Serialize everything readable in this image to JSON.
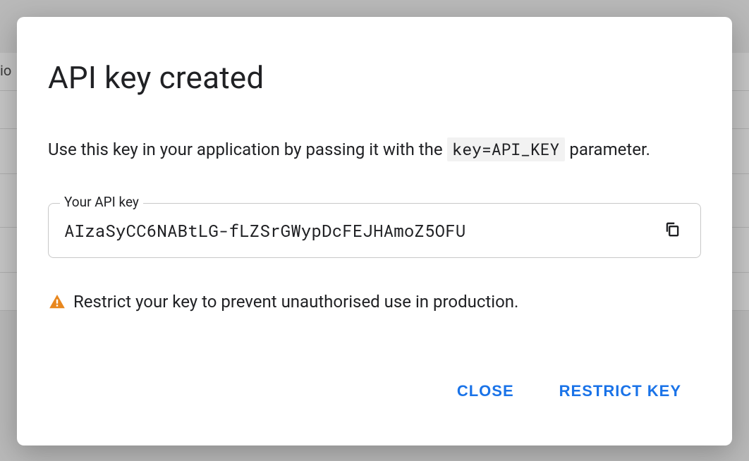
{
  "background": {
    "partial_label": "io"
  },
  "dialog": {
    "title": "API key created",
    "intro_prefix": "Use this key in your application by passing it with the ",
    "intro_code": "key=API_KEY",
    "intro_suffix": " parameter.",
    "field_label": "Your API key",
    "api_key_value": "AIzaSyCC6NABtLG-fLZSrGWypDcFEJHAmoZ5OFU",
    "warning_text": "Restrict your key to prevent unauthorised use in production.",
    "actions": {
      "close_label": "CLOSE",
      "restrict_label": "RESTRICT KEY"
    }
  },
  "colors": {
    "primary": "#1a73e8",
    "warning": "#e8871e"
  }
}
